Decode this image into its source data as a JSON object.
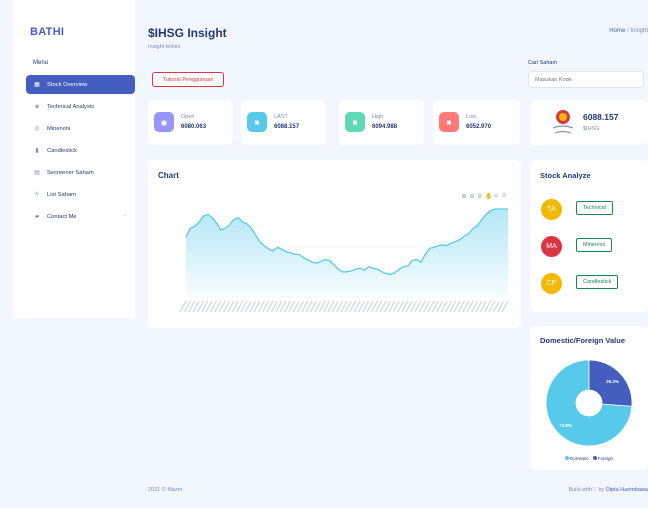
{
  "brand": "BATHI",
  "menu_title": "Menu",
  "menu": [
    {
      "label": "Stock Overview",
      "icon": "grid-icon",
      "glyph": "▦",
      "active": true
    },
    {
      "label": "Technical Analysis",
      "icon": "stack-icon",
      "glyph": "◈"
    },
    {
      "label": "Minervini",
      "icon": "coin-icon",
      "glyph": "◎"
    },
    {
      "label": "Candlestick",
      "icon": "bar-chart-icon",
      "glyph": "▮"
    },
    {
      "label": "Secreener Saham",
      "icon": "table-icon",
      "glyph": "▤"
    },
    {
      "label": "List Saham",
      "icon": "lightning-icon",
      "glyph": "ϟ"
    },
    {
      "label": "Contact Me",
      "icon": "briefcase-icon",
      "glyph": "▰",
      "chevron": "⌄"
    }
  ],
  "header": {
    "title": "$IHSG Insight",
    "subtitle": "Insight terkini",
    "breadcrumb_home": "Home",
    "breadcrumb_sep": " / ",
    "breadcrumb_current": "Insight"
  },
  "tutorial_button": "Tutorial Penggunaan",
  "search": {
    "label": "Cari Saham",
    "placeholder": "Masukan Kode"
  },
  "stats": [
    {
      "label": "Open",
      "value": "6080.063",
      "color": "#9694ff",
      "icon": "eye-icon",
      "glyph": "◉"
    },
    {
      "label": "LAST",
      "value": "6088.157",
      "color": "#57caeb",
      "icon": "square-icon",
      "glyph": "■"
    },
    {
      "label": "High",
      "value": "6094.988",
      "color": "#5ddab4",
      "icon": "square-icon",
      "glyph": "■"
    },
    {
      "label": "Low",
      "value": "6052.970",
      "color": "#ff7976",
      "icon": "square-icon",
      "glyph": "■"
    }
  ],
  "ihsg": {
    "price": "6088.157",
    "symbol": "$IHSG"
  },
  "chart": {
    "title": "Chart",
    "tools": [
      "zoom-in-icon",
      "zoom-out-icon",
      "search-icon",
      "pan-icon",
      "home-icon",
      "menu-icon"
    ],
    "tool_glyphs": [
      "⊕",
      "⊖",
      "⚲",
      "✋",
      "⌂",
      "≡"
    ]
  },
  "chart_data": {
    "type": "area",
    "values": [
      6030,
      6040,
      6042,
      6047,
      6054,
      6056,
      6052,
      6046,
      6038,
      6040,
      6044,
      6050,
      6052,
      6047,
      6045,
      6040,
      6032,
      6024,
      6020,
      6016,
      6014,
      6018,
      6016,
      6013,
      6012,
      6010,
      6010,
      6006,
      6004,
      6001,
      6000,
      6002,
      6004,
      6003,
      5998,
      5993,
      5990,
      5990,
      5991,
      5993,
      5994,
      5992,
      5996,
      5994,
      5993,
      5990,
      5988,
      5987,
      5989,
      5993,
      5996,
      5997,
      6003,
      6004,
      6001,
      6010,
      6017,
      6018,
      6020,
      6021,
      6020,
      6023,
      6025,
      6027,
      6031,
      6034,
      6040,
      6043,
      6050,
      6056,
      6060,
      6062,
      6062,
      6062,
      6062
    ]
  },
  "stock_analyze": {
    "title": "Stock Analyze",
    "items": [
      {
        "initials": "TA",
        "color": "#f5b800",
        "label": "Technical"
      },
      {
        "initials": "MA",
        "color": "#dc3545",
        "label": "Minervini"
      },
      {
        "initials": "CP",
        "color": "#f5b800",
        "label": "Candlestick"
      }
    ]
  },
  "domestic_foreign": {
    "title": "Domestic/Foreign Value",
    "slices": [
      {
        "name": "Domestic",
        "value": 73.8,
        "label": "73.8%",
        "color": "#57caeb"
      },
      {
        "name": "Foreign",
        "value": 26.2,
        "label": "26.2%",
        "color": "#435ebe"
      }
    ]
  },
  "footer": {
    "left": "2021 © Mazer",
    "right_prefix": "Build with",
    "heart": "♡",
    "by": " by ",
    "author": "Dipta Harimbawa"
  }
}
